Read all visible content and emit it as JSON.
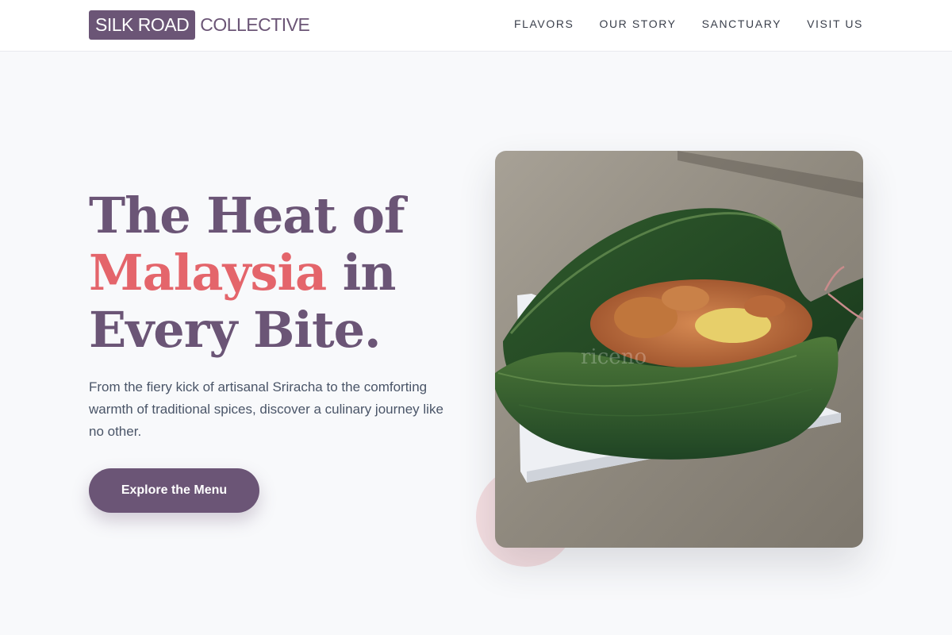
{
  "brand": {
    "logo_box": "SILK ROAD",
    "logo_rest": "COLLECTIVE"
  },
  "nav": {
    "items": [
      {
        "label": "FLAVORS"
      },
      {
        "label": "OUR STORY"
      },
      {
        "label": "SANCTUARY"
      },
      {
        "label": "VISIT US"
      }
    ]
  },
  "hero": {
    "headline_part1": "The Heat of",
    "headline_accent": "Malaysia",
    "headline_part2": " in",
    "headline_part3": "Every Bite.",
    "lead": "From the fiery kick of artisanal Sriracha to the comforting warmth of traditional spices, discover a culinary journey like no other.",
    "cta_label": "Explore the Menu"
  },
  "photo": {
    "watermark": "riceno"
  },
  "colors": {
    "brand_purple": "#6b5576",
    "accent_coral": "#e4656b",
    "background": "#f8f9fb"
  }
}
